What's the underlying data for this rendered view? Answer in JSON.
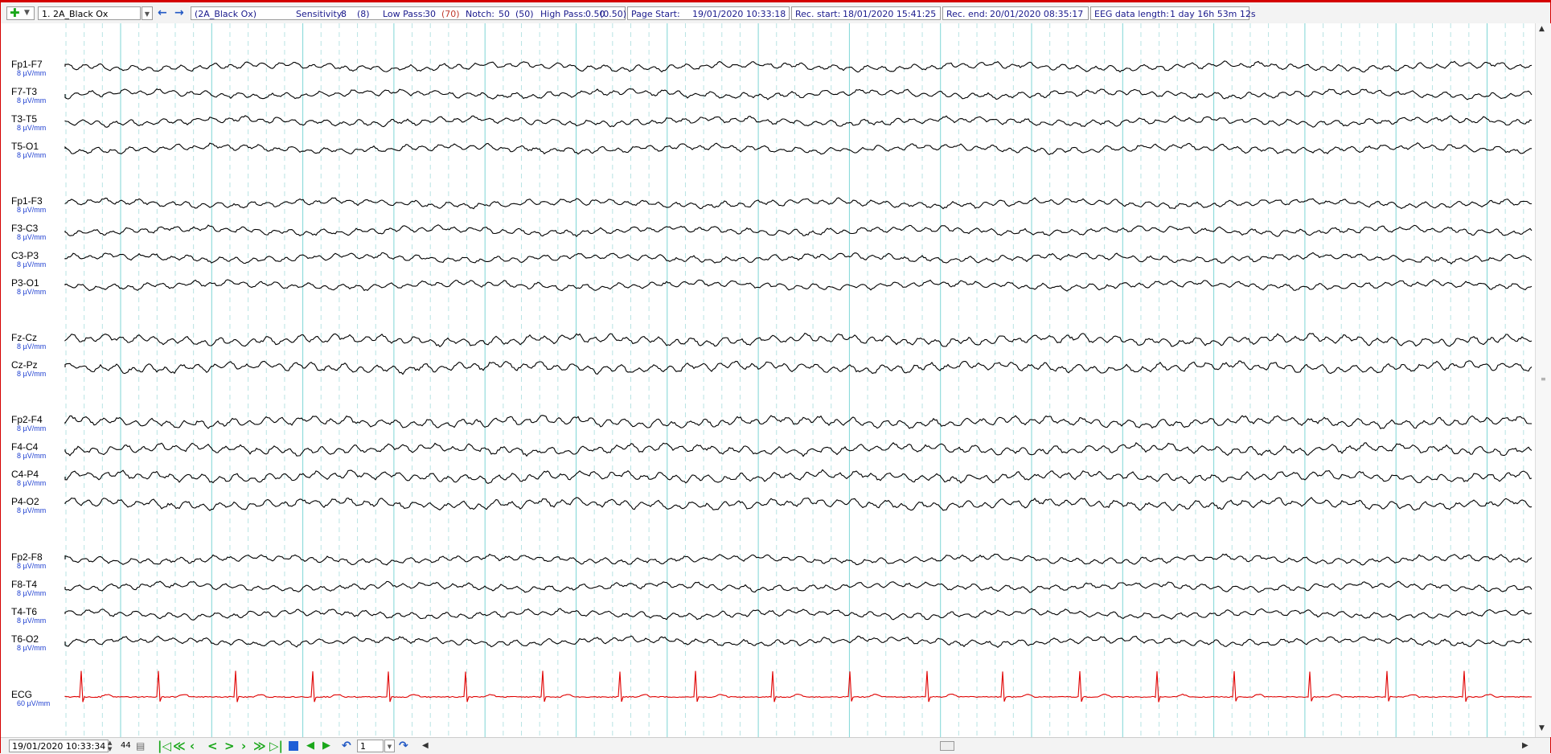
{
  "toolbar": {
    "add_icon": "plus-icon",
    "montage_label": "1. 2A_Black Ox",
    "montage_name": "(2A_Black Ox)",
    "sensitivity_label": "Sensitivity:",
    "sensitivity_value": "8",
    "sensitivity_default": "(8)",
    "lowpass_label": "Low Pass:",
    "lowpass_value": "30",
    "lowpass_default": "(70)",
    "notch_label": "Notch:",
    "notch_value": "50",
    "notch_default": "(50)",
    "highpass_label": "High Pass:",
    "highpass_value": "0.50",
    "highpass_default": "(0.50)",
    "page_start_label": "Page Start:",
    "page_start_value": "19/01/2020 10:33:18",
    "rec_start_label": "Rec. start:",
    "rec_start_value": "18/01/2020 15:41:25",
    "rec_end_label": "Rec. end:",
    "rec_end_value": "20/01/2020 08:35:17",
    "eeg_length_label": "EEG data length:",
    "eeg_length_value": "1 day 16h 53m 12s"
  },
  "channels": [
    {
      "name": "Fp1-F7",
      "sens": "8 µV/mm"
    },
    {
      "name": "F7-T3",
      "sens": "8 µV/mm"
    },
    {
      "name": "T3-T5",
      "sens": "8 µV/mm"
    },
    {
      "name": "T5-O1",
      "sens": "8 µV/mm"
    },
    {
      "name": "Fp1-F3",
      "sens": "8 µV/mm"
    },
    {
      "name": "F3-C3",
      "sens": "8 µV/mm"
    },
    {
      "name": "C3-P3",
      "sens": "8 µV/mm"
    },
    {
      "name": "P3-O1",
      "sens": "8 µV/mm"
    },
    {
      "name": "Fz-Cz",
      "sens": "8 µV/mm"
    },
    {
      "name": "Cz-Pz",
      "sens": "8 µV/mm"
    },
    {
      "name": "Fp2-F4",
      "sens": "8 µV/mm"
    },
    {
      "name": "F4-C4",
      "sens": "8 µV/mm"
    },
    {
      "name": "C4-P4",
      "sens": "8 µV/mm"
    },
    {
      "name": "P4-O2",
      "sens": "8 µV/mm"
    },
    {
      "name": "Fp2-F8",
      "sens": "8 µV/mm"
    },
    {
      "name": "F8-T4",
      "sens": "8 µV/mm"
    },
    {
      "name": "T4-T6",
      "sens": "8 µV/mm"
    },
    {
      "name": "T6-O2",
      "sens": "8 µV/mm"
    },
    {
      "name": "ECG",
      "sens": "60 µV/mm",
      "ecg": true
    }
  ],
  "bottom": {
    "time_value": "19/01/2020 10:33:34",
    "page_count": "44",
    "page_number": "1"
  },
  "colors": {
    "trace": "#000000",
    "ecg_trace": "#e00000",
    "second_line": "#7fd6d6",
    "sub_line": "#b8e3e3",
    "sensitivity_text": "#1e3fd0",
    "border": "#d40000"
  }
}
